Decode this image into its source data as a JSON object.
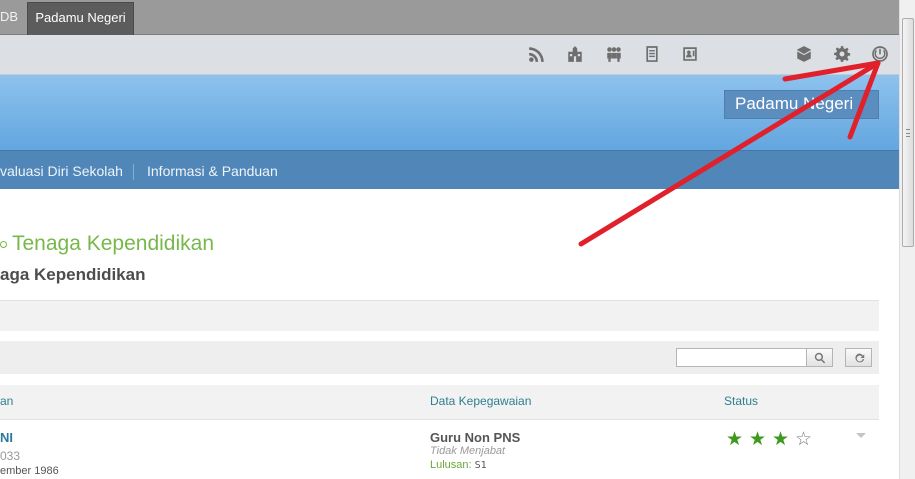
{
  "tabs": {
    "partial_label": "DB",
    "active_label": "Padamu Negeri"
  },
  "toolbar": {
    "icons": [
      "rss-icon",
      "school-icon",
      "people-icon",
      "document-icon",
      "contact-card-icon",
      "box-icon",
      "gear-icon",
      "power-icon"
    ]
  },
  "header": {
    "brand": "Padamu Negeri"
  },
  "nav": {
    "items": [
      {
        "label": "valuasi Diri Sekolah"
      },
      {
        "label": "Informasi & Panduan"
      }
    ]
  },
  "page": {
    "title": "Tenaga Kependidikan",
    "subtitle": "aga Kependidikan"
  },
  "search": {
    "value": "",
    "placeholder": ""
  },
  "table": {
    "columns": [
      "an",
      "Data Kepegawaian",
      "Status"
    ],
    "rows": [
      {
        "name": "NI",
        "number": "033",
        "birth": "ember 1986",
        "employment": "Guru Non PNS",
        "duty": "Tidak Menjabat",
        "education_label": "Lulusan:",
        "education_value": "S1",
        "rating": 3,
        "rating_max": 4
      }
    ]
  },
  "colors": {
    "header_blue": "#63a6df",
    "nav_blue": "#5086b8",
    "title_green": "#77b84a",
    "star_green": "#3e9a1e",
    "annotation_red": "#e0202a"
  }
}
